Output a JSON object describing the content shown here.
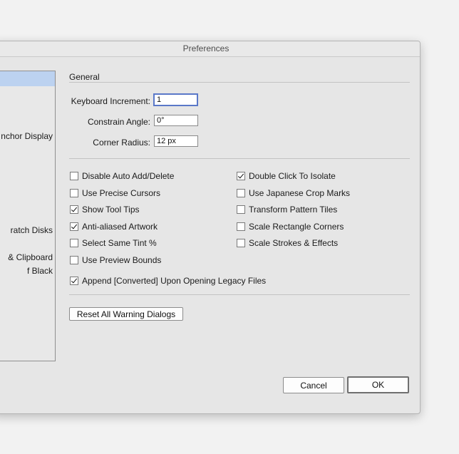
{
  "window": {
    "title": "Preferences"
  },
  "sidebar": {
    "items": [
      {
        "label": "nchor Display"
      },
      {
        "label": "ratch Disks"
      },
      {
        "label": "& Clipboard"
      },
      {
        "label": "f Black"
      }
    ]
  },
  "general": {
    "title": "General",
    "keyboard_increment": {
      "label": "Keyboard Increment:",
      "value": "1"
    },
    "constrain_angle": {
      "label": "Constrain Angle:",
      "value": "0°"
    },
    "corner_radius": {
      "label": "Corner Radius:",
      "value": "12 px"
    }
  },
  "options_left": [
    {
      "label": "Disable Auto Add/Delete",
      "checked": false
    },
    {
      "label": "Use Precise Cursors",
      "checked": false
    },
    {
      "label": "Show Tool Tips",
      "checked": true
    },
    {
      "label": "Anti-aliased Artwork",
      "checked": true
    },
    {
      "label": "Select Same Tint %",
      "checked": false
    },
    {
      "label": "Use Preview Bounds",
      "checked": false
    }
  ],
  "options_right": [
    {
      "label": "Double Click To Isolate",
      "checked": true
    },
    {
      "label": "Use Japanese Crop Marks",
      "checked": false
    },
    {
      "label": "Transform Pattern Tiles",
      "checked": false
    },
    {
      "label": "Scale Rectangle Corners",
      "checked": false
    },
    {
      "label": "Scale Strokes & Effects",
      "checked": false
    }
  ],
  "append_converted": {
    "label": "Append [Converted] Upon Opening Legacy Files",
    "checked": true
  },
  "buttons": {
    "reset_warnings": "Reset All Warning Dialogs",
    "cancel": "Cancel",
    "ok": "OK"
  }
}
